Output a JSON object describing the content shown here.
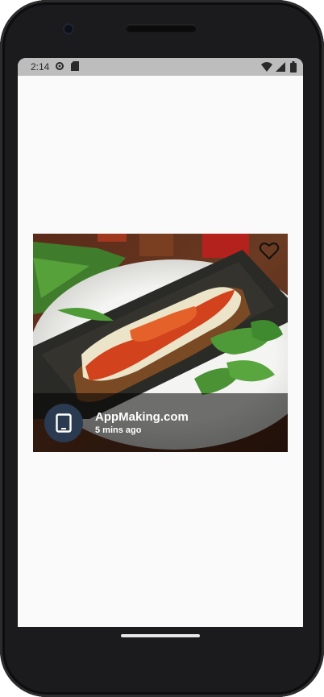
{
  "status_bar": {
    "time": "2:14",
    "icons": [
      "gear-icon",
      "sd-card-icon",
      "wifi-icon",
      "signal-icon",
      "battery-icon"
    ]
  },
  "post_card": {
    "image": "food-photo",
    "favorite_icon": "heart-outline-icon",
    "author": "AppMaking.com",
    "time_ago": "5 mins ago",
    "avatar_icon": "tablet-icon"
  },
  "colors": {
    "status_bar_bg": "#bdbdbd",
    "screen_bg": "#fafafa",
    "avatar_bg": "#2a3a50"
  }
}
